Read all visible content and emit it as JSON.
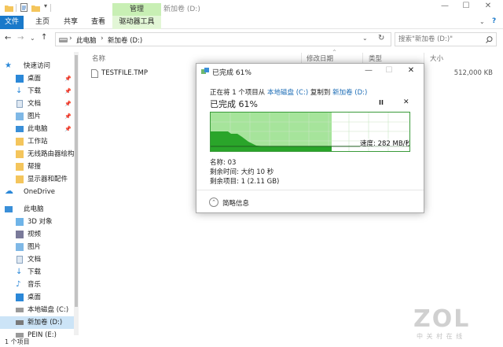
{
  "window": {
    "title": "新加卷 (D:)",
    "contextual_group": "管理",
    "controls": {
      "minimize": "—",
      "maximize": "☐",
      "close": "✕"
    }
  },
  "ribbon": {
    "tabs": [
      "文件",
      "主页",
      "共享",
      "查看",
      "驱动器工具"
    ]
  },
  "address": {
    "crumbs": [
      "此电脑",
      "新加卷 (D:)"
    ],
    "separator": "›",
    "search_placeholder": "搜索\"新加卷 (D:)\""
  },
  "sidebar": {
    "quick_access": "快速访问",
    "quick_items": [
      "桌面",
      "下载",
      "文档",
      "图片",
      "此电脑",
      "工作站",
      "无线路由器绘构",
      "帮搜",
      "显示器和配件"
    ],
    "onedrive": "OneDrive",
    "this_pc": "此电脑",
    "pc_items": [
      "3D 对象",
      "视频",
      "图片",
      "文档",
      "下载",
      "音乐",
      "桌面",
      "本地磁盘 (C:)",
      "新加卷 (D:)",
      "PEIN (E:)"
    ]
  },
  "file_list": {
    "columns": [
      "名称",
      "修改日期",
      "类型",
      "大小"
    ],
    "files": [
      {
        "name": "TESTFILE.TMP",
        "size": "512,000 KB"
      }
    ]
  },
  "status": {
    "item_count": "1 个项目"
  },
  "dialog": {
    "title": "已完成 61%",
    "summary_prefix": "正在将 1 个项目从",
    "source": "本地磁盘 (C:)",
    "summary_mid": "复制到",
    "destination": "新加卷 (D:)",
    "progress_label": "已完成 61%",
    "progress_fraction": 0.61,
    "speed": "速度: 282 MB/秒",
    "name_line": "名称: 03",
    "time_left": "剩余时间: 大约 10 秒",
    "items_left": "剩余项目: 1 (2.11 GB)",
    "details_toggle": "简略信息",
    "pause_symbol": "II",
    "cancel_symbol": "✕"
  },
  "watermark": {
    "logo": "ZOL",
    "tagline": "中 关 村 在 线"
  },
  "colors": {
    "accent": "#1979ca",
    "progress_fill": "#a6e49b",
    "graph_line": "#1e7a1e",
    "selection": "#cce4f7",
    "context_tab": "#c8efb4"
  }
}
